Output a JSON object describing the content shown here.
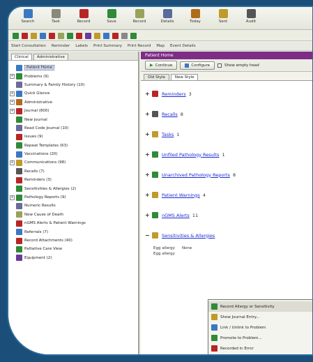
{
  "toolbar": [
    {
      "label": "Search",
      "icon": "search-icon",
      "color": "#3a78c4"
    },
    {
      "label": "Task",
      "icon": "task-icon",
      "color": "#8a8a7a"
    },
    {
      "label": "Record",
      "icon": "record-icon",
      "color": "#b82525"
    },
    {
      "label": "Save",
      "icon": "save-icon",
      "color": "#2f8a3a"
    },
    {
      "label": "Record",
      "icon": "record-doc-icon",
      "color": "#9aa25a"
    },
    {
      "label": "Details",
      "icon": "details-icon",
      "color": "#5a6a9a"
    },
    {
      "label": "Today",
      "icon": "today-icon",
      "color": "#b06a1a"
    },
    {
      "label": "Sent",
      "icon": "sent-icon",
      "color": "#c09a2a"
    },
    {
      "label": "Audit",
      "icon": "audit-icon",
      "color": "#555555"
    }
  ],
  "toolbar2_colors": [
    "#2f8a3a",
    "#b82525",
    "#c09a2a",
    "#3a78c4",
    "#b82525",
    "#9aa25a",
    "#2f8a3a",
    "#b82525",
    "#6a3a9a",
    "#c09a2a",
    "#3a78c4",
    "#b82525",
    "#888888",
    "#2f8a3a"
  ],
  "menu": [
    "Start Consultation",
    "Reminder",
    "Labels",
    "Print Summary",
    "Print Record",
    "Map",
    "Event Details"
  ],
  "left": {
    "tabs": [
      "Clinical",
      "Administrative"
    ],
    "tree": [
      {
        "label": "Patient Home",
        "color": "#3a78c4",
        "exp": "",
        "sel": true
      },
      {
        "label": "Problems (9)",
        "color": "#2f8a3a",
        "exp": "+"
      },
      {
        "label": "Summary & Family History (10)",
        "color": "#6a6a9a",
        "exp": ""
      },
      {
        "label": "Quick Glance",
        "color": "#3a78c4",
        "exp": "+"
      },
      {
        "label": "Administrative",
        "color": "#b06a1a",
        "exp": "+"
      },
      {
        "label": "Journal (800)",
        "color": "#b82525",
        "exp": "+"
      },
      {
        "label": "New Journal",
        "color": "#2f8a3a",
        "exp": ""
      },
      {
        "label": "Read Code Journal (10)",
        "color": "#6a6a9a",
        "exp": ""
      },
      {
        "label": "Issues (9)",
        "color": "#b82525",
        "exp": ""
      },
      {
        "label": "Repeat Templates (63)",
        "color": "#2f8a3a",
        "exp": ""
      },
      {
        "label": "Vaccinations (20)",
        "color": "#3a78c4",
        "exp": ""
      },
      {
        "label": "Communications (98)",
        "color": "#c09a2a",
        "exp": "+"
      },
      {
        "label": "Recalls (7)",
        "color": "#555555",
        "exp": ""
      },
      {
        "label": "Reminders (3)",
        "color": "#b82525",
        "exp": ""
      },
      {
        "label": "Sensitivities & Allergies (2)",
        "color": "#2f8a3a",
        "exp": ""
      },
      {
        "label": "Pathology Reports (9)",
        "color": "#2f8a3a",
        "exp": "+"
      },
      {
        "label": "Numeric Results",
        "color": "#6a6a9a",
        "exp": ""
      },
      {
        "label": "New Cause of Death",
        "color": "#9aa25a",
        "exp": ""
      },
      {
        "label": "nGMS Alerts & Patient Warnings",
        "color": "#b82525",
        "exp": ""
      },
      {
        "label": "Referrals (7)",
        "color": "#3a78c4",
        "exp": ""
      },
      {
        "label": "Record Attachments (40)",
        "color": "#b82525",
        "exp": ""
      },
      {
        "label": "Palliative Care View",
        "color": "#2f8a3a",
        "exp": ""
      },
      {
        "label": "Equipment (2)",
        "color": "#6a3a9a",
        "exp": ""
      }
    ]
  },
  "right": {
    "header": "Patient Home",
    "continue_label": "Continue",
    "configure_label": "Configure",
    "show_empty_label": "Show empty head",
    "tabs": [
      "Old Style",
      "New Style"
    ],
    "sections": [
      {
        "pm": "+",
        "label": "Reminders",
        "count": "3",
        "color": "#b82525"
      },
      {
        "pm": "+",
        "label": "Recalls",
        "count": "8",
        "color": "#555555"
      },
      {
        "pm": "+",
        "label": "Tasks",
        "count": "1",
        "color": "#c09a2a"
      },
      {
        "pm": "+",
        "label": "Unfiled Pathology Results",
        "count": "1",
        "color": "#2f8a3a"
      },
      {
        "pm": "+",
        "label": "Unarchived Pathology Reports",
        "count": "8",
        "color": "#2f8a3a"
      },
      {
        "pm": "+",
        "label": "Patient Warnings",
        "count": "4",
        "color": "#c09a2a"
      },
      {
        "pm": "+",
        "label": "nGMS Alerts",
        "count": "11",
        "color": "#2f8a3a"
      },
      {
        "pm": "−",
        "label": "Sensitivities & Allergies",
        "count": "",
        "color": "#c09a2a"
      }
    ],
    "allergies": [
      {
        "a": "Egg allergy",
        "b": "None"
      },
      {
        "a": "Egg allergy",
        "b": ""
      }
    ]
  },
  "context_menu": [
    {
      "label": "Record Allergy or Sensitivity",
      "color": "#2f8a3a"
    },
    {
      "label": "Show Journal Entry...",
      "color": "#c09a2a"
    },
    {
      "label": "Link / Unlink to Problem",
      "color": "#3a78c4"
    },
    {
      "label": "Promote to Problem...",
      "color": "#2f8a3a"
    },
    {
      "label": "Recorded in Error",
      "color": "#b82525"
    }
  ]
}
